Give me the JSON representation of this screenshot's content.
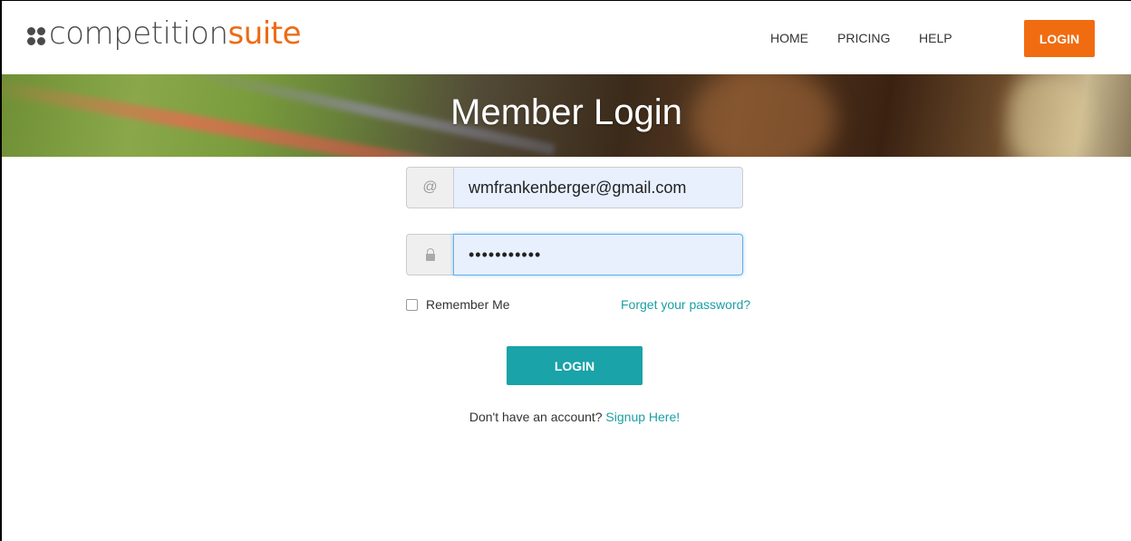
{
  "header": {
    "logo": {
      "part1": "competition",
      "part2": "suite"
    },
    "nav": [
      {
        "label": "HOME"
      },
      {
        "label": "PRICING"
      },
      {
        "label": "HELP"
      }
    ],
    "login_label": "LOGIN",
    "accent": "#f16c10"
  },
  "banner": {
    "title": "Member Login"
  },
  "form": {
    "email_icon": "@",
    "email_value": "wmfrankenberger@gmail.com",
    "password_value": "•••••••••••",
    "remember_label": "Remember Me",
    "forgot_label": "Forget your password?",
    "submit_label": "LOGIN",
    "submit_color": "#1aa3a8",
    "signup_text": "Don't have an account?",
    "signup_link": "Signup Here!"
  }
}
